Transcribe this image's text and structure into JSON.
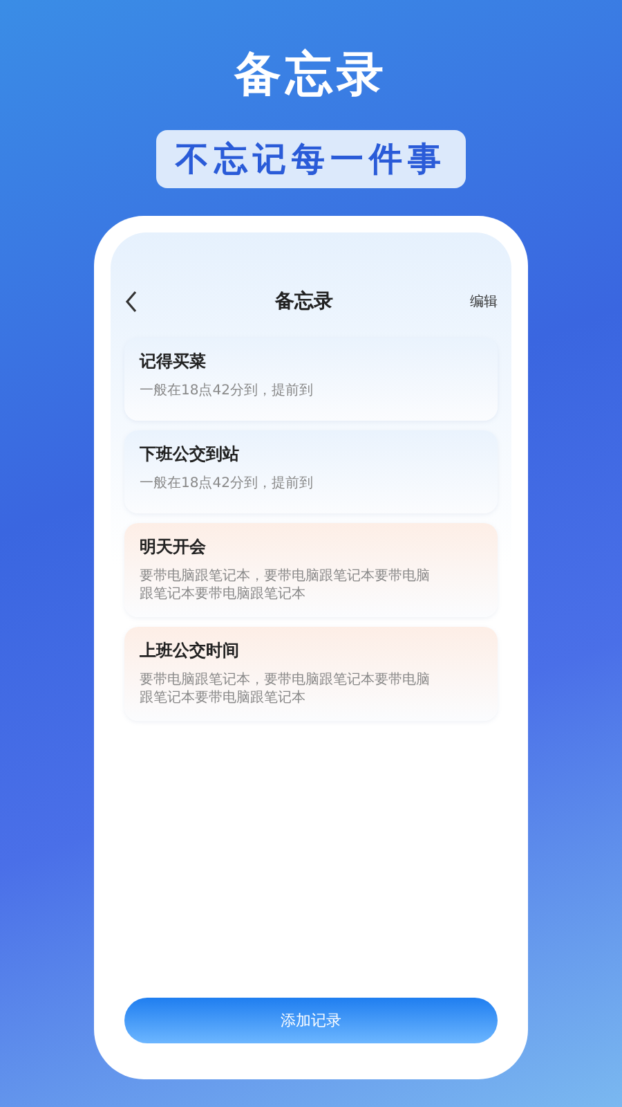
{
  "headline": "备忘录",
  "tagline": "不忘记每一件事",
  "screen": {
    "title": "备忘录",
    "edit": "编辑",
    "notes": [
      {
        "title": "记得买菜",
        "body": "一般在18点42分到，提前到",
        "color": "#eaf3fd"
      },
      {
        "title": "下班公交到站",
        "body": "一般在18点42分到，提前到",
        "color": "#eaf3fd"
      },
      {
        "title": "明天开会",
        "body": "要带电脑跟笔记本，要带电脑跟笔记本要带电脑跟笔记本要带电脑跟笔记本",
        "color": "#fdeee6"
      },
      {
        "title": "上班公交时间",
        "body": "要带电脑跟笔记本，要带电脑跟笔记本要带电脑跟笔记本要带电脑跟笔记本",
        "color": "#fdeee6"
      }
    ],
    "add_button": "添加记录"
  }
}
